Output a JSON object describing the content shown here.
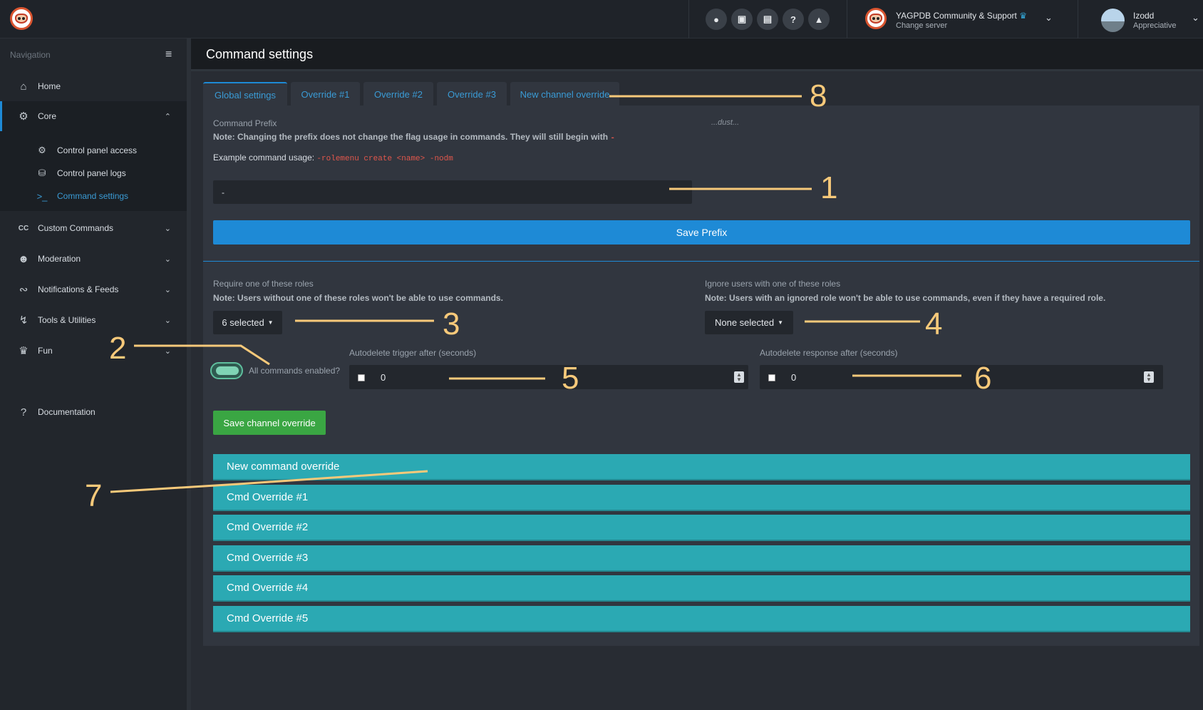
{
  "topbar": {
    "server_name": "YAGPDB Community & Support",
    "server_sub": "Change server",
    "user_name": "Izodd",
    "user_sub": "Appreciative",
    "icons": [
      "bulb-icon",
      "chat-icon",
      "news-icon",
      "help-icon",
      "warning-icon"
    ]
  },
  "sidebar": {
    "heading": "Navigation",
    "items": [
      {
        "label": "Home",
        "icon": "home-icon"
      },
      {
        "label": "Core",
        "icon": "gears-icon"
      },
      {
        "label": "Custom Commands",
        "icon": "cc-icon"
      },
      {
        "label": "Moderation",
        "icon": "user-shield-icon"
      },
      {
        "label": "Notifications & Feeds",
        "icon": "rss-icon"
      },
      {
        "label": "Tools & Utilities",
        "icon": "bolt-icon"
      },
      {
        "label": "Fun",
        "icon": "trophy-icon"
      },
      {
        "label": "Documentation",
        "icon": "question-icon"
      }
    ],
    "core_sub": [
      {
        "label": "Control panel access",
        "icon": "gear-icon"
      },
      {
        "label": "Control panel logs",
        "icon": "database-icon"
      },
      {
        "label": "Command settings",
        "icon": "terminal-icon"
      }
    ]
  },
  "header": {
    "title": "Command settings"
  },
  "tabs": [
    "Global settings",
    "Override #1",
    "Override #2",
    "Override #3",
    "New channel override"
  ],
  "prefix": {
    "label": "Command Prefix",
    "dust": "...dust...",
    "note": "Note: Changing the prefix does not change the flag usage in commands. They will still begin with",
    "note_code": "-",
    "example_label": "Example command usage:",
    "example_code": "-rolemenu create <name> -nodm",
    "value": "-",
    "save_label": "Save Prefix"
  },
  "roles": {
    "require_label": "Require one of these roles",
    "require_note": "Note: Users without one of these roles won't be able to use commands.",
    "require_value": "6 selected",
    "ignore_label": "Ignore users with one of these roles",
    "ignore_note": "Note: Users with an ignored role won't be able to use commands, even if they have a required role.",
    "ignore_value": "None selected"
  },
  "toggle": {
    "label": "All commands enabled?",
    "on": true
  },
  "autodelete": {
    "trigger_label": "Autodelete trigger after (seconds)",
    "trigger_value": "0",
    "response_label": "Autodelete response after (seconds)",
    "response_value": "0"
  },
  "save_override_label": "Save channel override",
  "command_overrides": [
    "New command override",
    "Cmd Override #1",
    "Cmd Override #2",
    "Cmd Override #3",
    "Cmd Override #4",
    "Cmd Override #5"
  ],
  "annotations": [
    "1",
    "2",
    "3",
    "4",
    "5",
    "6",
    "7",
    "8"
  ],
  "colors": {
    "accent": "#1e8ad6",
    "success": "#3aa643",
    "teal": "#2ba9b3",
    "annotation": "#f7c97a"
  }
}
